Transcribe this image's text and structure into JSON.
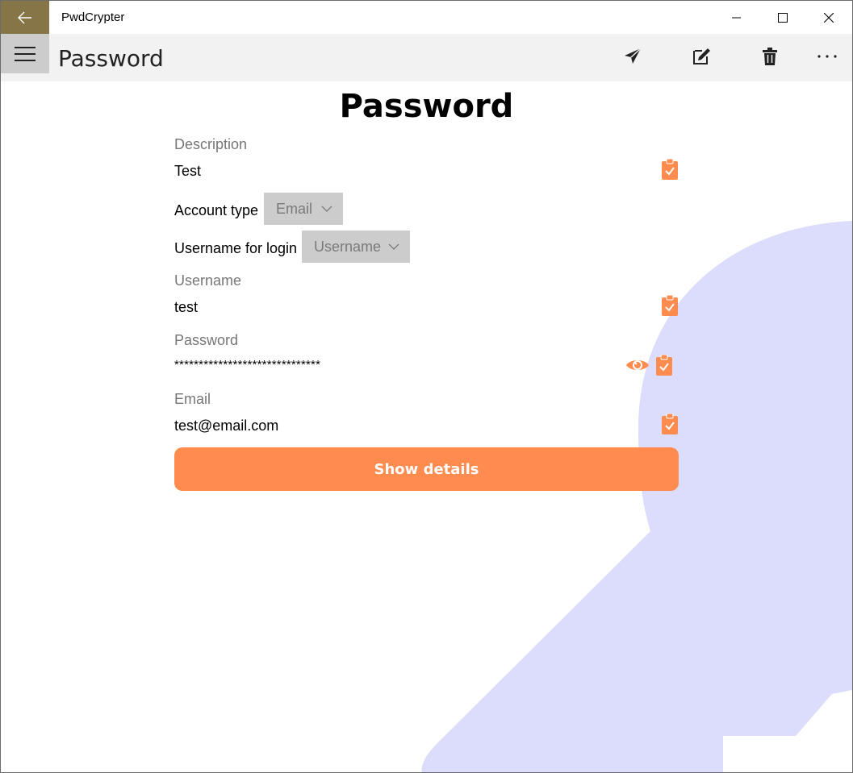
{
  "window": {
    "app_title": "PwdCrypter",
    "back_icon": "arrow-left-icon",
    "controls": [
      "minimize-icon",
      "maximize-icon",
      "close-icon"
    ]
  },
  "command_bar": {
    "page_title": "Password",
    "actions": [
      "send-icon",
      "edit-icon",
      "delete-icon",
      "more-icon"
    ]
  },
  "main": {
    "heading": "Password",
    "description_label": "Description",
    "description_value": "Test",
    "account_type_label": "Account type",
    "account_type_value": "Email",
    "username_for_login_label": "Username for login",
    "username_for_login_value": "Username",
    "username_label": "Username",
    "username_value": "test",
    "password_label": "Password",
    "password_value": "******************************",
    "email_label": "Email",
    "email_value": "test@email.com",
    "show_details_button": "Show details"
  },
  "colors": {
    "accent": "#ff8c4e",
    "titlebar_back": "#857547",
    "watermark": "#dcdcfc"
  }
}
